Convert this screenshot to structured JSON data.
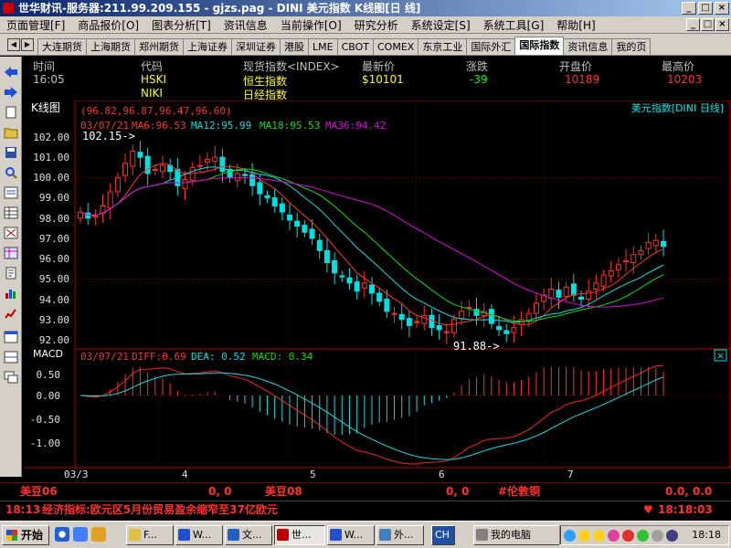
{
  "window": {
    "title": "世华财讯-服务器:211.99.209.155  - gjzs.pag - DINI 美元指数 K线图[日 线]",
    "min_glyph": "_",
    "max_glyph": "□",
    "close_glyph": "×"
  },
  "menu": {
    "items": [
      "页面管理[F]",
      "商品报价[O]",
      "图表分析[T]",
      "资讯信息",
      "当前操作[O]",
      "研究分析",
      "系统设定[S]",
      "系统工具[G]",
      "帮助[H]"
    ],
    "mdi_min": "_",
    "mdi_max": "□",
    "mdi_close": "×"
  },
  "tabs": {
    "prev": "◀",
    "next": "▶",
    "items": [
      "大连期货",
      "上海期货",
      "郑州期货",
      "上海证券",
      "深圳证券",
      "港股",
      "LME",
      "CBOT",
      "COMEX",
      "东京工业",
      "国际外汇",
      "国际指数",
      "资讯信息",
      "我的页"
    ],
    "active_index": 11
  },
  "quote": {
    "headers": [
      "时间",
      "代码",
      "现货指数<INDEX>",
      "最新价",
      "涨跌",
      "开盘价",
      "最高价"
    ],
    "row1": [
      "16:05",
      "HSKI",
      "恒生指数",
      "$10101",
      "-39",
      "10189",
      "10203"
    ],
    "row2": [
      "NIKI",
      "日经指数"
    ]
  },
  "chart_panel": {
    "title": "K线图",
    "ohlc_readout": "(96.82,96.87,96.47,96.60)",
    "date_label": "03/07/21",
    "ma_labels": [
      "MA6:96.53",
      "MA12:95.99",
      "MA18:95.53",
      "MA36:94.42"
    ],
    "instrument": "美元指数[DINI 日线]",
    "high_marker": "102.15->",
    "low_marker": "91.88->",
    "y_ticks": [
      "102.00",
      "101.00",
      "100.00",
      "99.00",
      "98.00",
      "97.00",
      "96.00",
      "95.00",
      "94.00",
      "93.00",
      "92.00"
    ],
    "x_ticks": [
      "03/3",
      "4",
      "5",
      "6",
      "7"
    ],
    "macd_title": "MACD",
    "macd_date": "03/07/21",
    "macd_labels": [
      "DIFF:0.69",
      "DEA: 0.52",
      "MACD: 0.34"
    ],
    "macd_ticks": [
      "0.50",
      "0.00",
      "-0.50",
      "-1.00"
    ],
    "close_glyph": "×",
    "colors": {
      "up": "#ff3030",
      "down": "#00e0e0",
      "ma6": "#ff3030",
      "ma12": "#00e0e0",
      "ma18": "#00e000",
      "ma36": "#e000e0",
      "diff": "#ff2020",
      "dea": "#00e0e0"
    }
  },
  "status": {
    "left_name": "美豆06",
    "left_value": "0, 0",
    "mid_name": "美豆08",
    "mid_value": "0, 0",
    "right_name": "#伦敦铜",
    "right_value": "0.0, 0.0"
  },
  "news": {
    "time": "18:13",
    "text": "经济指标:欧元区5月份贸易盈余缩窄至37亿欧元",
    "clock": "18:18:03",
    "heart": "♥"
  },
  "taskbar": {
    "start": "开始",
    "buttons": [
      "F...",
      "W...",
      "文...",
      "世...",
      "W...",
      "外...",
      "CH",
      "我的电脑"
    ],
    "clock": "18:18"
  },
  "chart_data": [
    {
      "type": "candlestick",
      "title": "美元指数[DINI 日线]",
      "ylim": [
        91.5,
        102.5
      ],
      "x_ticks": [
        "03/3",
        "4",
        "5",
        "6",
        "7"
      ],
      "series_names": [
        "MA6",
        "MA12",
        "MA18",
        "MA36"
      ],
      "last_values": {
        "MA6": 96.53,
        "MA12": 95.99,
        "MA18": 95.53,
        "MA36": 94.42
      },
      "last_ohlc": [
        96.82,
        96.87,
        96.47,
        96.6
      ],
      "high": 102.15,
      "low": 91.88,
      "closes": [
        98.3,
        98.0,
        98.1,
        98.6,
        99.3,
        100.0,
        100.7,
        101.3,
        101.0,
        100.2,
        100.4,
        100.6,
        100.3,
        99.6,
        99.9,
        100.5,
        100.6,
        100.9,
        101.0,
        100.3,
        100.0,
        100.2,
        100.1,
        99.6,
        99.2,
        99.0,
        98.6,
        98.3,
        97.9,
        97.6,
        97.3,
        97.0,
        96.4,
        95.8,
        95.3,
        95.1,
        94.8,
        94.4,
        94.8,
        94.3,
        93.9,
        93.4,
        93.3,
        93.0,
        92.7,
        92.9,
        93.2,
        92.6,
        92.5,
        92.4,
        93.0,
        93.4,
        93.6,
        93.2,
        93.4,
        92.8,
        92.5,
        92.3,
        92.6,
        93.0,
        93.3,
        93.8,
        94.2,
        94.5,
        94.1,
        94.6,
        94.2,
        94.0,
        94.4,
        94.8,
        95.2,
        95.4,
        95.7,
        95.9,
        96.2,
        96.4,
        96.8,
        96.9,
        96.6
      ]
    },
    {
      "type": "bar",
      "title": "MACD",
      "series_names": [
        "DIFF",
        "DEA",
        "MACD"
      ],
      "last_values": {
        "DIFF": 0.69,
        "DEA": 0.52,
        "MACD": 0.34
      },
      "ylim": [
        -1.3,
        0.8
      ]
    }
  ]
}
